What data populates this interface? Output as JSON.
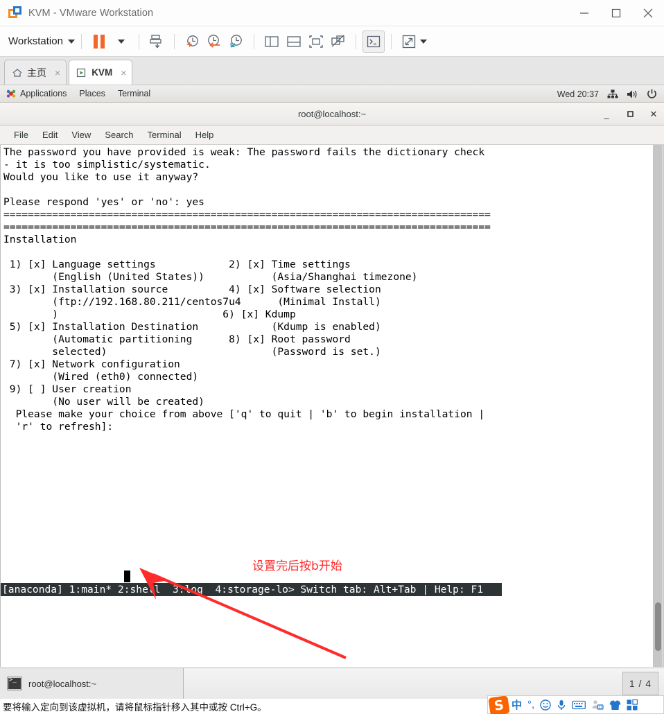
{
  "vmware": {
    "title": "KVM - VMware Workstation",
    "app_icon": "vmware-logo-icon",
    "window_controls": [
      {
        "name": "minimize-button",
        "glyph": "minimize-icon"
      },
      {
        "name": "maximize-button",
        "glyph": "maximize-icon"
      },
      {
        "name": "close-button",
        "glyph": "close-icon"
      }
    ],
    "toolbar": {
      "workstation_menu": "Workstation",
      "buttons": [
        {
          "name": "suspend-button",
          "icon": "pause-icon"
        },
        {
          "name": "power-dropdown-button",
          "icon": "chevron-down-icon"
        },
        {
          "name": "send-ctrl-alt-del-button",
          "icon": "snapshot-save-icon"
        },
        {
          "name": "take-snapshot-button",
          "icon": "snapshot-add-icon"
        },
        {
          "name": "revert-snapshot-button",
          "icon": "snapshot-revert-icon"
        },
        {
          "name": "snapshot-manager-button",
          "icon": "snapshot-manager-icon"
        },
        {
          "name": "show-sidebar-button",
          "icon": "panel-left-icon"
        },
        {
          "name": "show-thumbnail-button",
          "icon": "panel-bottom-icon"
        },
        {
          "name": "fit-guest-button",
          "icon": "fit-window-icon"
        },
        {
          "name": "multiple-monitors-button",
          "icon": "monitors-off-icon"
        },
        {
          "name": "console-view-button",
          "icon": "terminal-icon"
        },
        {
          "name": "full-screen-button",
          "icon": "fullscreen-icon"
        },
        {
          "name": "full-screen-dropdown-button",
          "icon": "chevron-down-icon"
        }
      ]
    },
    "tabs": [
      {
        "name": "tab-home",
        "label": "主页",
        "icon": "home-icon",
        "active": false,
        "close": "×"
      },
      {
        "name": "tab-kvm",
        "label": "KVM",
        "icon": "vm-play-icon",
        "active": true,
        "close": "×"
      }
    ],
    "status_task": "root@localhost:~",
    "pager": "1 / 4",
    "hint": "要将输入定向到该虚拟机，请将鼠标指针移入其中或按 Ctrl+G。"
  },
  "gnome_panel": {
    "applications": "Applications",
    "places": "Places",
    "terminal": "Terminal",
    "clock": "Wed 20:37",
    "tray": [
      {
        "name": "network-icon"
      },
      {
        "name": "volume-icon"
      },
      {
        "name": "power-icon"
      }
    ]
  },
  "terminal_window": {
    "title": "root@localhost:~",
    "window_buttons": [
      {
        "name": "gt-minimize-button",
        "glyph": "_"
      },
      {
        "name": "gt-maximize-button",
        "glyph": "❏"
      },
      {
        "name": "gt-close-button",
        "glyph": "✕"
      }
    ],
    "menus": [
      "File",
      "Edit",
      "View",
      "Search",
      "Terminal",
      "Help"
    ],
    "lines": [
      "The password you have provided is weak: The password fails the dictionary check",
      "- it is too simplistic/systematic.",
      "Would you like to use it anyway?",
      "",
      "Please respond 'yes' or 'no': yes",
      "================================================================================",
      "================================================================================",
      "Installation",
      "",
      " 1) [x] Language settings            2) [x] Time settings",
      "        (English (United States))           (Asia/Shanghai timezone)",
      " 3) [x] Installation source          4) [x] Software selection",
      "        (ftp://192.168.80.211/centos7u4      (Minimal Install)",
      "        )                           6) [x] Kdump",
      " 5) [x] Installation Destination            (Kdump is enabled)",
      "        (Automatic partitioning      8) [x] Root password",
      "        selected)                           (Password is set.)",
      " 7) [x] Network configuration",
      "        (Wired (eth0) connected)",
      " 9) [ ] User creation",
      "        (No user will be created)",
      "  Please make your choice from above ['q' to quit | 'b' to begin installation |",
      "  'r' to refresh]: "
    ],
    "status_bar": "[anaconda] 1:main* 2:shell  3:log  4:storage-lo> Switch tab: Alt+Tab | Help: F1",
    "status_bar_bg": "#2e3436",
    "status_bar_fg": "#ffffff",
    "cursor": "block"
  },
  "annotation": {
    "text": "设置完后按b开始",
    "color": "#ff2a2a",
    "arrow": "red-arrow-icon"
  },
  "sogou": {
    "logo": "S",
    "items": [
      {
        "name": "chinese-mode-icon",
        "glyph": "中"
      },
      {
        "name": "punctuation-mode-icon",
        "glyph": "°,"
      },
      {
        "name": "emoji-icon",
        "glyph": "☺"
      },
      {
        "name": "voice-input-icon",
        "glyph": "mic"
      },
      {
        "name": "soft-keyboard-icon",
        "glyph": "keyboard"
      },
      {
        "name": "user-account-icon",
        "glyph": "user12"
      },
      {
        "name": "skin-icon",
        "glyph": "shirt"
      },
      {
        "name": "toolbox-icon",
        "glyph": "grid"
      }
    ]
  }
}
